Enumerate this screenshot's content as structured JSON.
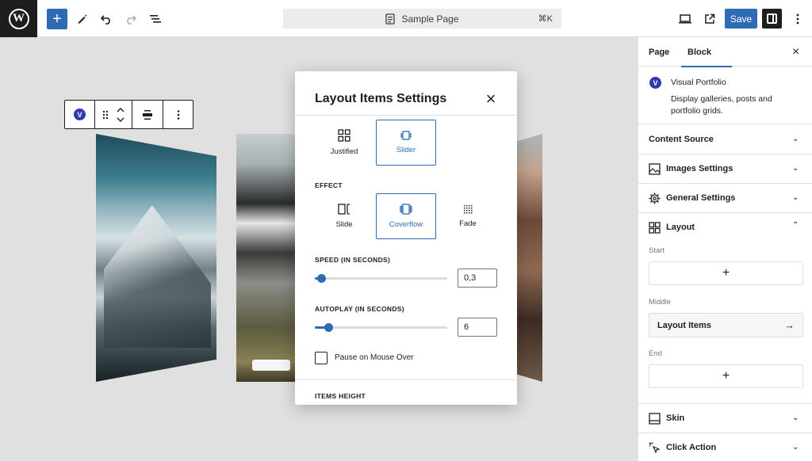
{
  "topbar": {
    "logo_letter": "W",
    "add_label": "+",
    "document_title": "Sample Page",
    "shortcut": "⌘K",
    "save_label": "Save"
  },
  "block_toolbar": {
    "badge_letter": "V"
  },
  "modal": {
    "title": "Layout Items Settings",
    "close": "×",
    "layout_options": [
      {
        "label": "Justified",
        "icon": "justified-grid-icon",
        "selected": false
      },
      {
        "label": "Slider",
        "icon": "slider-icon",
        "selected": true
      }
    ],
    "effect_label": "EFFECT",
    "effect_options": [
      {
        "label": "Slide",
        "icon": "slide-icon",
        "selected": false
      },
      {
        "label": "Coverflow",
        "icon": "coverflow-icon",
        "selected": true
      },
      {
        "label": "Fade",
        "icon": "fade-icon",
        "selected": false
      }
    ],
    "speed": {
      "label": "SPEED (IN SECONDS)",
      "value": "0,3",
      "fraction": 0.05
    },
    "autoplay": {
      "label": "AUTOPLAY (IN SECONDS)",
      "value": "6",
      "fraction": 0.1
    },
    "pause_label": "Pause on Mouse Over",
    "pause_checked": false,
    "items_height_label": "ITEMS HEIGHT"
  },
  "sidebar": {
    "tabs": [
      "Page",
      "Block"
    ],
    "active_tab": "Block",
    "close": "×",
    "plugin": {
      "badge_letter": "V",
      "name": "Visual Portfolio",
      "description": "Display galleries, posts and portfolio grids."
    },
    "panels": [
      {
        "label": "Content Source",
        "icon": "",
        "expanded": false
      },
      {
        "label": "Images Settings",
        "icon": "image-icon",
        "expanded": false
      },
      {
        "label": "General Settings",
        "icon": "gear-icon",
        "expanded": false
      },
      {
        "label": "Layout",
        "icon": "layout-icon",
        "expanded": true
      },
      {
        "label": "Skin",
        "icon": "skin-icon",
        "expanded": false
      },
      {
        "label": "Click Action",
        "icon": "cursor-click-icon",
        "expanded": false
      }
    ],
    "layout": {
      "start_label": "Start",
      "middle_label": "Middle",
      "end_label": "End",
      "add_symbol": "+",
      "middle_item": "Layout Items",
      "arrow": "→"
    }
  },
  "colors": {
    "accent": "#2d6cb5",
    "dark": "#1e1e1e",
    "canvas": "#e0e0e0",
    "border": "#e0e0e0"
  }
}
